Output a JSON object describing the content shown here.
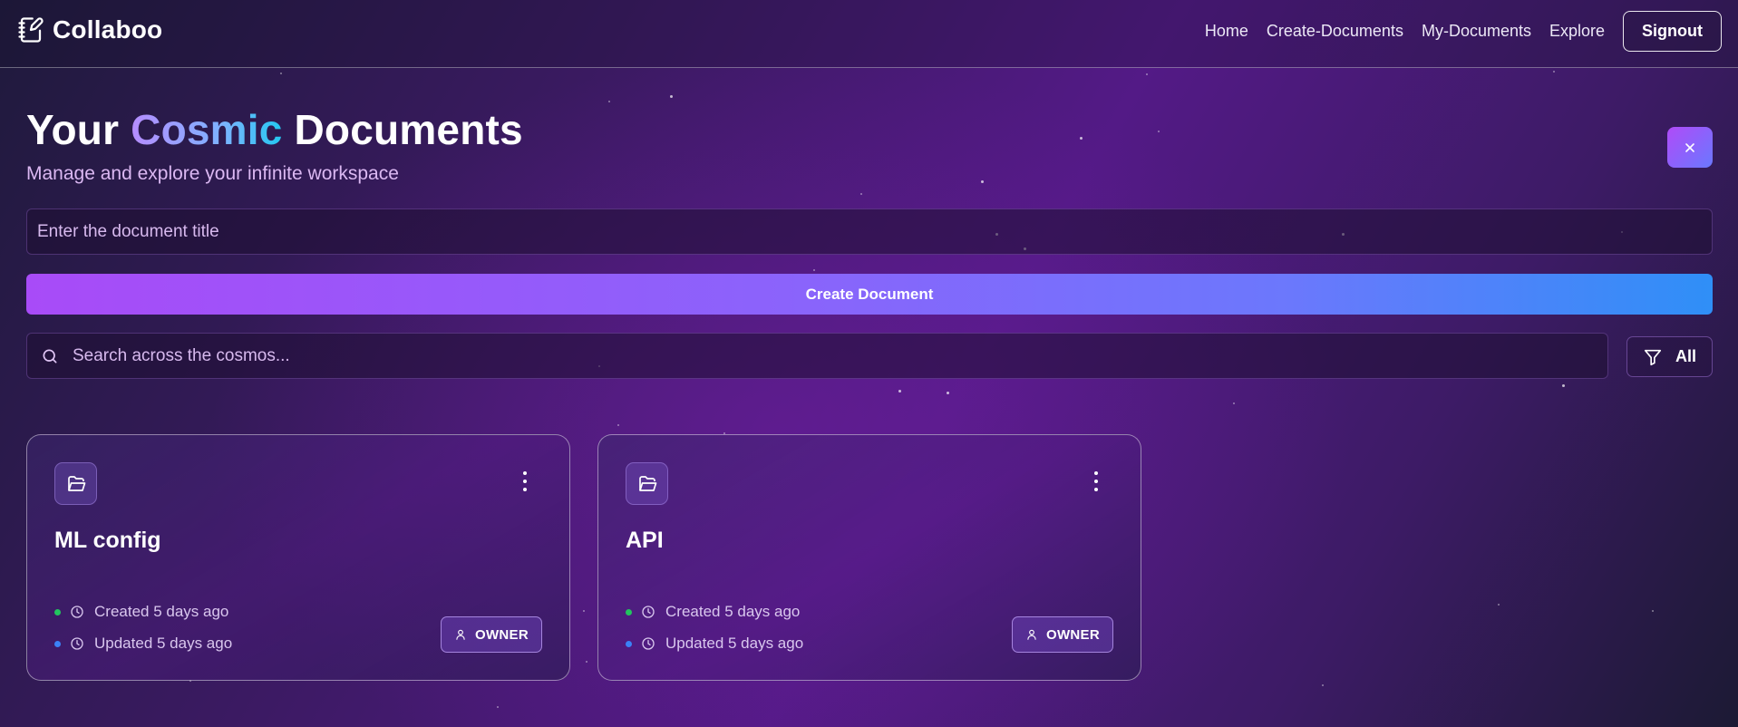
{
  "app": {
    "name": "Collaboo",
    "logo_icon": "notebook-pen-icon"
  },
  "nav": {
    "links": [
      "Home",
      "Create-Documents",
      "My-Documents",
      "Explore"
    ],
    "signout_label": "Signout"
  },
  "hero": {
    "title_part1": "Your",
    "title_accent": "Cosmic",
    "title_part2": "Documents",
    "subtitle": "Manage and explore your infinite workspace"
  },
  "create": {
    "title_placeholder": "Enter the document title",
    "title_value": "",
    "button_label": "Create Document"
  },
  "search": {
    "placeholder": "Search across the cosmos...",
    "value": "",
    "filter_label": "All"
  },
  "documents": [
    {
      "title": "ML config",
      "created": "Created 5 days ago",
      "updated": "Updated 5 days ago",
      "role": "OWNER"
    },
    {
      "title": "API",
      "created": "Created 5 days ago",
      "updated": "Updated 5 days ago",
      "role": "OWNER"
    }
  ],
  "colors": {
    "created_dot": "#22c55e",
    "updated_dot": "#3b82f6",
    "accent_gradient_start": "#a84bf8",
    "accent_gradient_end": "#2f8ff7"
  }
}
